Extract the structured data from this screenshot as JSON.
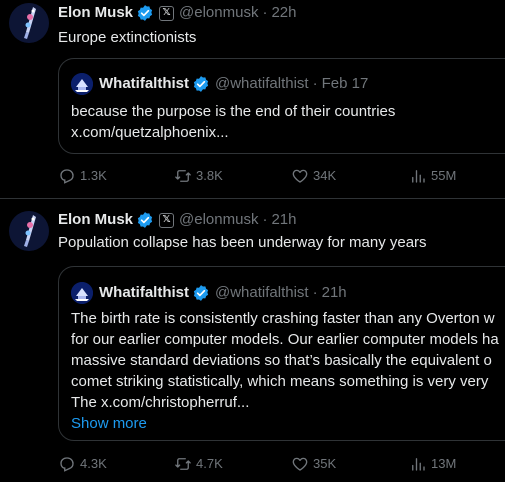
{
  "tweets": [
    {
      "author_name": "Elon Musk",
      "author_handle": "@elonmusk",
      "x_badge": "𝕏",
      "separator": "·",
      "time": "22h",
      "text": "Europe extinctionists",
      "quote": {
        "author_name": "Whatifalthist",
        "author_handle": "@whatifalthist",
        "separator": "·",
        "time": "Feb 17",
        "lines": [
          "because the purpose is the end of their countries",
          "x.com/quetzalphoenix..."
        ]
      },
      "stats": {
        "replies": "1.3K",
        "reposts": "3.8K",
        "likes": "34K",
        "views": "55M"
      }
    },
    {
      "author_name": "Elon Musk",
      "author_handle": "@elonmusk",
      "x_badge": "𝕏",
      "separator": "·",
      "time": "21h",
      "text": "Population collapse has been underway for many years",
      "quote": {
        "author_name": "Whatifalthist",
        "author_handle": "@whatifalthist",
        "separator": "·",
        "time": "21h",
        "lines": [
          "The birth rate is consistently crashing faster than any Overton w",
          "for our earlier computer models. Our earlier computer models ha",
          "massive standard deviations so that’s basically the equivalent o",
          "comet striking statistically, which means something is very very",
          "The x.com/christopherruf..."
        ],
        "show_more": "Show more"
      },
      "stats": {
        "replies": "4.3K",
        "reposts": "4.7K",
        "likes": "35K",
        "views": "13M"
      }
    }
  ],
  "colors": {
    "background": "#000000",
    "text_primary": "#e7e9ea",
    "text_secondary": "#71767b",
    "border": "#2f3336",
    "accent": "#1d9bf0"
  },
  "icons": {
    "verified": "verified-badge-icon",
    "reply": "reply-icon",
    "repost": "repost-icon",
    "like": "heart-icon",
    "views": "views-bar-chart-icon"
  }
}
